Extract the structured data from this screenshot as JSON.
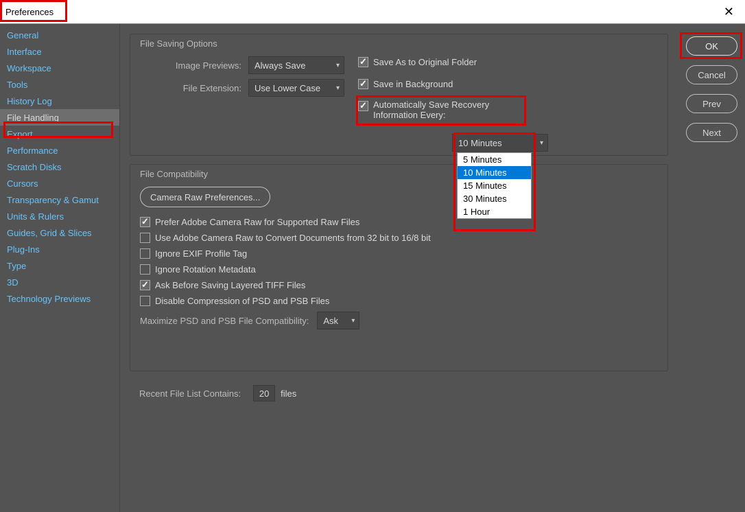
{
  "window": {
    "title": "Preferences",
    "close_glyph": "✕"
  },
  "sidebar": {
    "items": [
      "General",
      "Interface",
      "Workspace",
      "Tools",
      "History Log",
      "File Handling",
      "Export",
      "Performance",
      "Scratch Disks",
      "Cursors",
      "Transparency & Gamut",
      "Units & Rulers",
      "Guides, Grid & Slices",
      "Plug-Ins",
      "Type",
      "3D",
      "Technology Previews"
    ],
    "selected_index": 5
  },
  "buttons": {
    "ok": "OK",
    "cancel": "Cancel",
    "prev": "Prev",
    "next": "Next"
  },
  "file_saving": {
    "group_label": "File Saving Options",
    "image_previews_label": "Image Previews:",
    "image_previews_value": "Always Save",
    "file_extension_label": "File Extension:",
    "file_extension_value": "Use Lower Case",
    "save_as_original": {
      "checked": true,
      "label": "Save As to Original Folder"
    },
    "save_in_bg": {
      "checked": true,
      "label": "Save in Background"
    },
    "auto_save": {
      "checked": true,
      "label_line1": "Automatically Save Recovery",
      "label_line2": "Information Every:"
    },
    "interval_selected": "10 Minutes",
    "interval_options": [
      "5 Minutes",
      "10 Minutes",
      "15 Minutes",
      "30 Minutes",
      "1 Hour"
    ]
  },
  "file_compat": {
    "group_label": "File Compatibility",
    "camera_raw_btn": "Camera Raw Preferences...",
    "prefer_acr": {
      "checked": true,
      "label": "Prefer Adobe Camera Raw for Supported Raw Files"
    },
    "acr_convert": {
      "checked": false,
      "label": "Use Adobe Camera Raw to Convert Documents from 32 bit to 16/8 bit"
    },
    "ignore_exif": {
      "checked": false,
      "label": "Ignore EXIF Profile Tag"
    },
    "ignore_rotation": {
      "checked": false,
      "label": "Ignore Rotation Metadata"
    },
    "ask_tiff": {
      "checked": true,
      "label": "Ask Before Saving Layered TIFF Files"
    },
    "disable_psd_comp": {
      "checked": false,
      "label": "Disable Compression of PSD and PSB Files"
    },
    "max_compat_label": "Maximize PSD and PSB File Compatibility:",
    "max_compat_value": "Ask"
  },
  "recent": {
    "label": "Recent File List Contains:",
    "value": "20",
    "suffix": "files"
  }
}
